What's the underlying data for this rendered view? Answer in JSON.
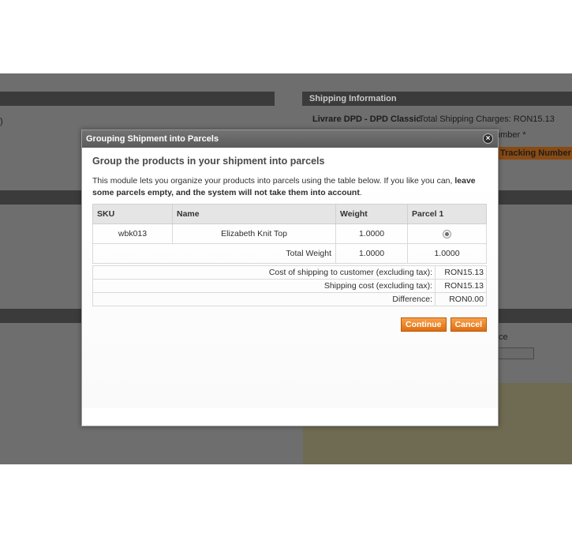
{
  "background": {
    "shipping_info_heading": "Shipping Information",
    "carrier_label": "Livrare DPD - DPD Classic",
    "total_charges_text": "Total Shipping Charges: RON15.13",
    "number_label": "umber *",
    "tracking_button": "Tracking Number",
    "left_partial_text": ")",
    "right_partial_text": "ce"
  },
  "modal": {
    "title": "Grouping Shipment into Parcels",
    "close_icon": "close-icon",
    "heading": "Group the products in your shipment into parcels",
    "intro_plain": "This module lets you organize your products into parcels using the table below. If you like you can, ",
    "intro_bold": "leave some parcels empty, and the system will not take them into account",
    "intro_end": ".",
    "table": {
      "headers": {
        "sku": "SKU",
        "name": "Name",
        "weight": "Weight",
        "parcel1": "Parcel 1"
      },
      "rows": [
        {
          "sku": "wbk013",
          "name": "Elizabeth Knit Top",
          "weight": "1.0000",
          "parcel_selected": true
        }
      ],
      "total_label": "Total Weight",
      "total_weight": "1.0000",
      "total_parcel1": "1.0000"
    },
    "summary": [
      {
        "label": "Cost of shipping to customer (excluding tax):",
        "value": "RON15.13"
      },
      {
        "label": "Shipping cost (excluding tax):",
        "value": "RON15.13"
      },
      {
        "label": "Difference:",
        "value": "RON0.00"
      }
    ],
    "continue_label": "Continue",
    "cancel_label": "Cancel"
  },
  "colors": {
    "accent": "#e98122",
    "header": "#666666",
    "overlay": "#6e6e6e"
  }
}
